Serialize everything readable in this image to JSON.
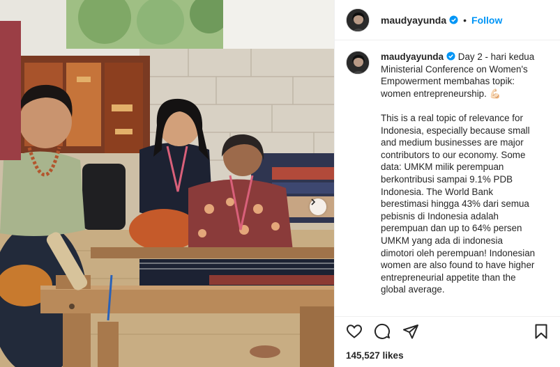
{
  "post": {
    "username": "maudyayunda",
    "follow_label": "Follow",
    "separator": "•",
    "caption_lines": [
      "Day 2 - hari kedua",
      "Ministerial Conference on Women's",
      "Empowerment membahas topik:",
      "women entrepreneurship. 💪🏻",
      "",
      "This is a real topic of relevance for",
      "Indonesia, especially because small",
      "and medium businesses are major",
      "contributors to our economy. Some",
      "data: UMKM milik perempuan",
      "berkontribusi sampai 9.1% PDB",
      "Indonesia. The World Bank",
      "berestimasi hingga 43% dari semua",
      "pebisnis di Indonesia adalah",
      "perempuan dan up to 64% persen",
      "UMKM yang ada di indonesia",
      "dimotori oleh perempuan! Indonesian",
      "women are also found to have higher",
      "entrepreneurial appetite than the",
      "global average."
    ],
    "likes": "145,527 likes"
  },
  "icons": {
    "verified": "verified-badge-icon",
    "more": "more-options-icon",
    "like": "heart-icon",
    "comment": "comment-icon",
    "share": "share-icon",
    "save": "bookmark-icon",
    "next": "chevron-right-icon"
  },
  "colors": {
    "accent": "#0095f6",
    "text": "#262626",
    "divider": "#efefef"
  }
}
